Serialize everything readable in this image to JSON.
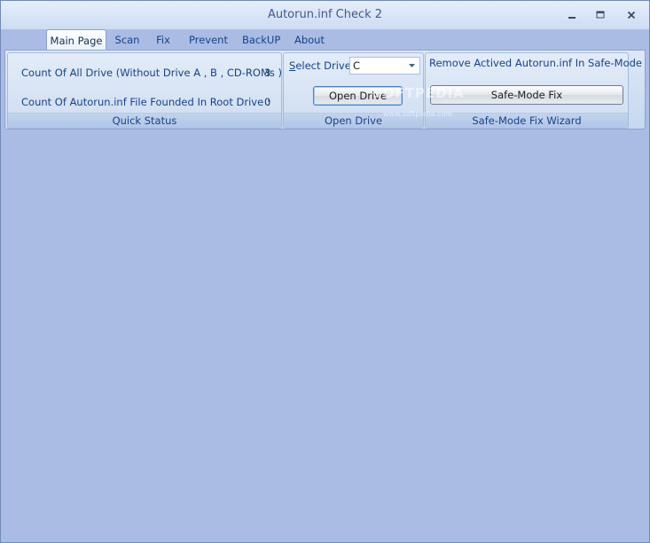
{
  "window": {
    "title": "Autorun.inf Check 2",
    "controls": {
      "minimize_icon": "minimize-icon",
      "maximize_icon": "maximize-icon",
      "close_icon": "close-icon"
    }
  },
  "tabs": [
    {
      "label": "Main Page",
      "active": true
    },
    {
      "label": "Scan"
    },
    {
      "label": "Fix"
    },
    {
      "label": "Prevent"
    },
    {
      "label": "BackUP"
    },
    {
      "label": "About"
    }
  ],
  "quick_status": {
    "drive_count_label": "Count Of All Drive (Without Drive A , B , CD-ROMs ) :",
    "drive_count_value": "3",
    "autorun_count_label": "Count Of Autorun.inf File Founded In Root Drive :",
    "autorun_count_value": "0",
    "footer": "Quick Status"
  },
  "open_drive": {
    "select_label_accel": "S",
    "select_label_rest": "elect Drive",
    "selected_drive": "C",
    "button_label": "Open Drive",
    "footer": "Open Drive"
  },
  "safe_mode": {
    "description": "Remove Actived Autorun.inf In Safe-Mode",
    "button_label": "Safe-Mode Fix",
    "footer": "Safe-Mode Fix Wizard"
  },
  "watermark": {
    "text": "SOFTPEDIA",
    "url": "www.softpedia.com"
  },
  "colors": {
    "client_background": "#aabce4",
    "ribbon_text": "#15428b",
    "title_text": "#3d5a8c"
  }
}
